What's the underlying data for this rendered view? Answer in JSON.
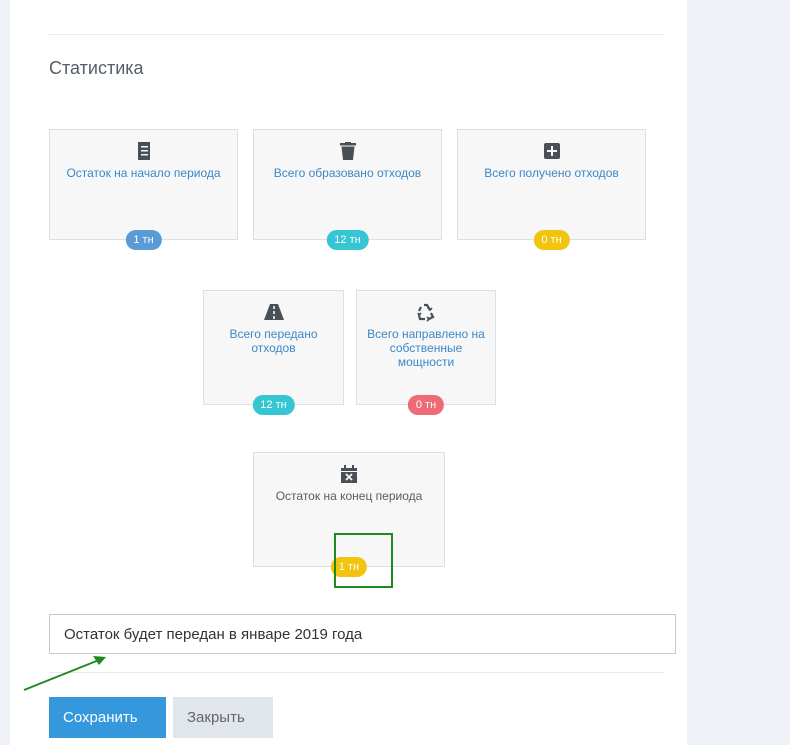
{
  "section_title": "Статистика",
  "cards": [
    {
      "icon": "document-stack-icon",
      "label": "Остаток на начало периода",
      "badge": "1 тн",
      "badge_color": "#5b9bd5"
    },
    {
      "icon": "trash-icon",
      "label": "Всего образовано отходов",
      "badge": "12 тн",
      "badge_color": "#36c6d3"
    },
    {
      "icon": "plus-square-icon",
      "label": "Всего получено отходов",
      "badge": "0 тн",
      "badge_color": "#f1c40f"
    },
    {
      "icon": "road-icon",
      "label": "Всего передано отходов",
      "badge": "12 тн",
      "badge_color": "#36c6d3"
    },
    {
      "icon": "recycle-icon",
      "label": "Всего направлено на собственные мощности",
      "badge": "0 тн",
      "badge_color": "#ed6b75"
    },
    {
      "icon": "calendar-x-icon",
      "label": "Остаток на конец периода",
      "badge": "1 тн",
      "badge_color": "#f1c40f"
    }
  ],
  "note_input": {
    "value": "Остаток будет передан в январе 2019 года"
  },
  "buttons": {
    "save": "Сохранить",
    "close": "Закрыть"
  },
  "colors": {
    "primary": "#3598dc",
    "highlight": "#1f8a1f",
    "link_text": "#3c87c8"
  }
}
